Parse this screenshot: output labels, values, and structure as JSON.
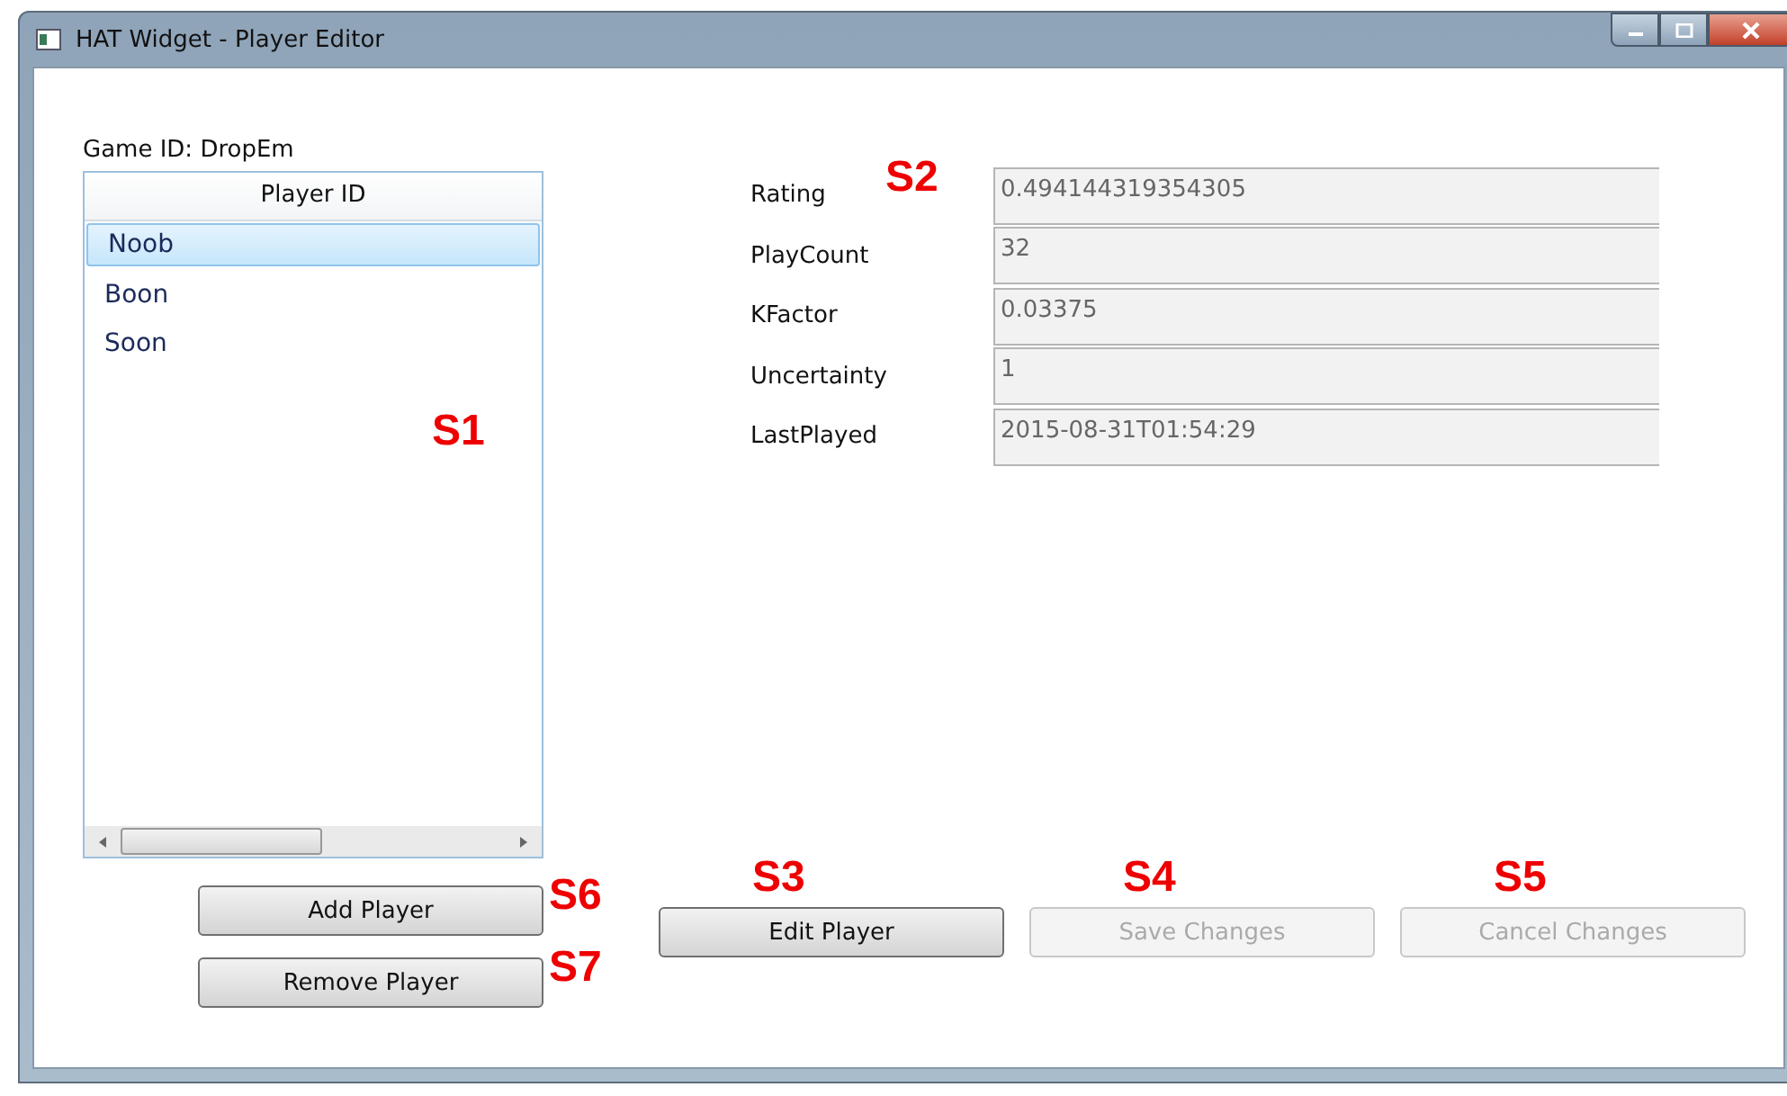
{
  "window": {
    "title": "HAT Widget - Player Editor"
  },
  "game_id": "Game ID: DropEm",
  "player_list": {
    "header": "Player ID",
    "marker": "S1",
    "items": [
      {
        "name": "Noob",
        "selected": true
      },
      {
        "name": "Boon",
        "selected": false
      },
      {
        "name": "Soon",
        "selected": false
      }
    ]
  },
  "details": {
    "marker": "S2",
    "fields": [
      {
        "label": "Rating",
        "value": "0.494144319354305"
      },
      {
        "label": "PlayCount",
        "value": "32"
      },
      {
        "label": "KFactor",
        "value": "0.03375"
      },
      {
        "label": "Uncertainty",
        "value": "1"
      },
      {
        "label": "LastPlayed",
        "value": "2015-08-31T01:54:29"
      }
    ]
  },
  "list_buttons": [
    {
      "label": "Add Player",
      "marker": "S6",
      "disabled": false
    },
    {
      "label": "Remove Player",
      "marker": "S7",
      "disabled": false
    }
  ],
  "edit_buttons": [
    {
      "label": "Edit Player",
      "marker": "S3",
      "disabled": false
    },
    {
      "label": "Save Changes",
      "marker": "S4",
      "disabled": true
    },
    {
      "label": "Cancel Changes",
      "marker": "S5",
      "disabled": true
    }
  ]
}
